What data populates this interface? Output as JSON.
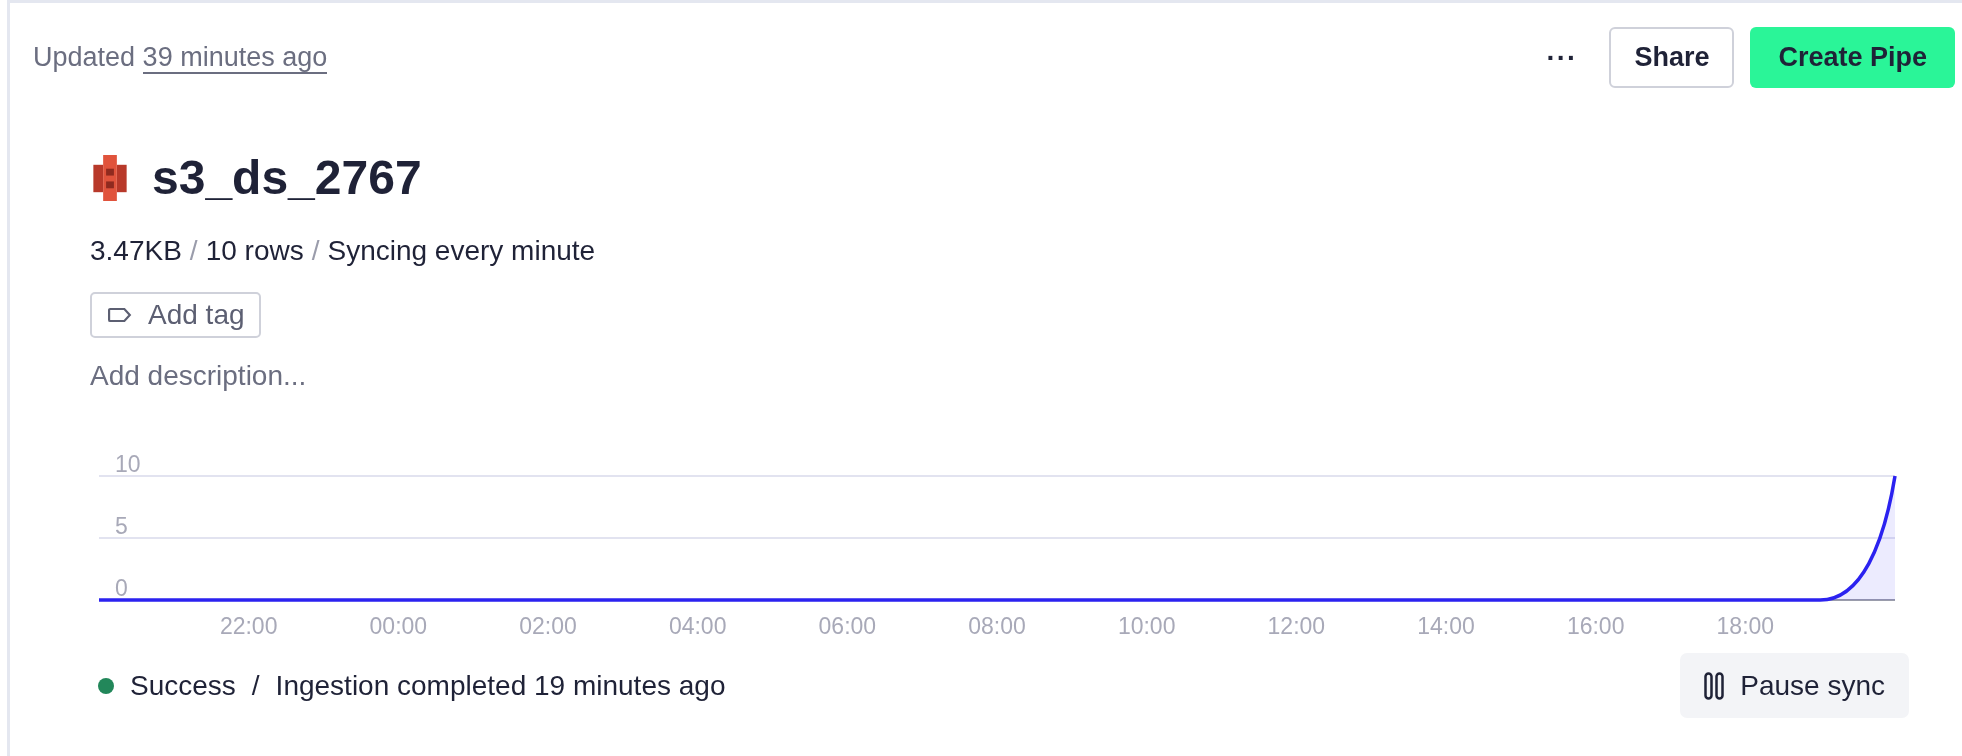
{
  "header": {
    "updated_label": "Updated",
    "updated_link": "39 minutes ago",
    "buttons": [
      {
        "label": "···",
        "kind": "more"
      },
      {
        "label": "Share",
        "kind": "outline"
      },
      {
        "label": "Create Pipe",
        "kind": "primary"
      }
    ]
  },
  "datasource": {
    "name": "s3_ds_2767",
    "meta": [
      {
        "text": "3.47KB",
        "kind": "value"
      },
      {
        "text": "/",
        "kind": "separator"
      },
      {
        "text": "10 rows",
        "kind": "value"
      },
      {
        "text": "/",
        "kind": "separator"
      },
      {
        "text": "Syncing every minute",
        "kind": "value"
      }
    ],
    "tag_button": "Add tag",
    "description_placeholder": "Add description..."
  },
  "chart_data": {
    "type": "area",
    "categories": [
      null,
      null,
      "22:00",
      null,
      "00:00",
      null,
      "02:00",
      null,
      "04:00",
      null,
      "06:00",
      null,
      "08:00",
      null,
      "10:00",
      null,
      "12:00",
      null,
      "14:00",
      null,
      "16:00",
      null,
      "18:00",
      null,
      null
    ],
    "series": [
      {
        "color": "#2b22f0",
        "values": [
          0,
          0,
          0,
          0,
          0,
          0,
          0,
          0,
          0,
          0,
          0,
          0,
          0,
          0,
          0,
          0,
          0,
          0,
          0,
          0,
          0,
          0,
          0,
          0,
          10
        ]
      }
    ],
    "ylim": [
      0,
      10
    ],
    "yticks": [
      0,
      5,
      10
    ]
  },
  "status": {
    "color": "#22875a",
    "label": "Success",
    "separator": "/",
    "message": "Ingestion completed 19 minutes ago"
  },
  "pause_button": "Pause sync"
}
